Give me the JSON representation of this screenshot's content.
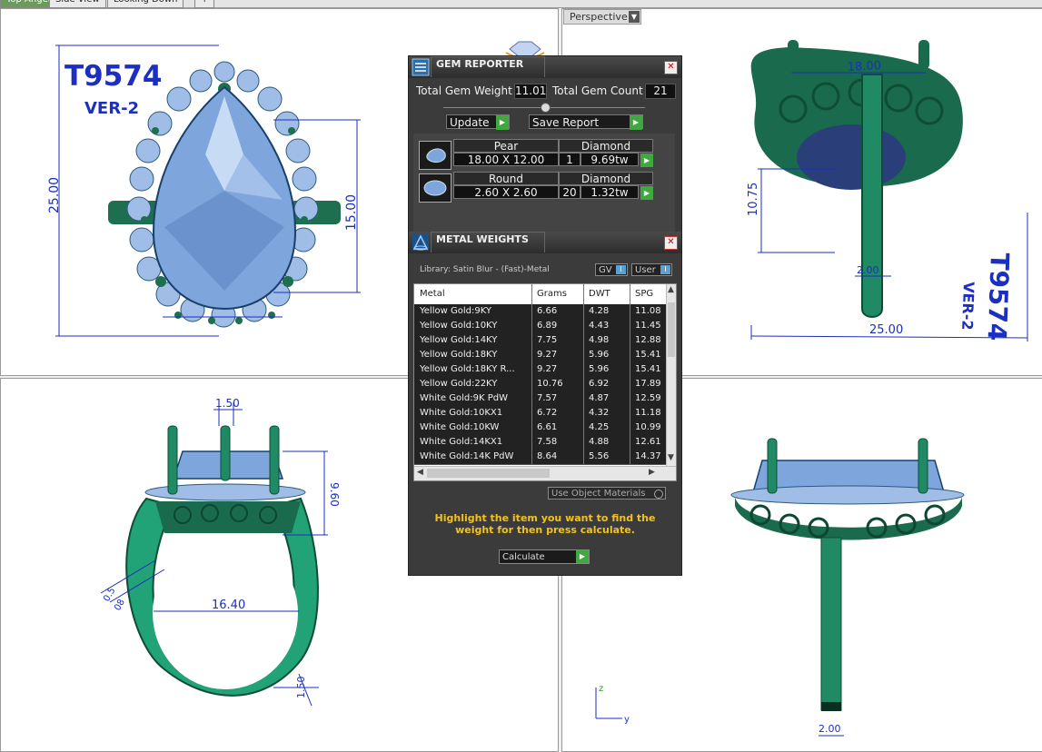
{
  "tabs": [
    {
      "label": "Top Angel",
      "active": true
    },
    {
      "label": "Side View",
      "active": false
    },
    {
      "label": "Looking Down",
      "active": false
    },
    {
      "label": "+",
      "active": false
    }
  ],
  "perspective": {
    "label": "Perspective",
    "arrow": "▼"
  },
  "top_left_view": {
    "model_id": "T9574",
    "version": "VER-2",
    "dim_height": "25.00",
    "dim_inner": "15.00"
  },
  "top_right_view": {
    "dim_top": "18.00",
    "dim_side": "10.75",
    "dim_shank": "2.00",
    "dim_bottom": "25.00",
    "model_id": "T9574",
    "version": "VER-2"
  },
  "bottom_left_view": {
    "dim_prong": "1.50",
    "dim_height": "9.60",
    "dim_inner": "16.40",
    "dim_shank": "1.50",
    "dim_angled_1": "0.5",
    "dim_angled_2": "08"
  },
  "bottom_right_view": {
    "dim_shank": "2.00",
    "axis_z": "z",
    "axis_y": "y"
  },
  "gem_reporter": {
    "title": "GEM REPORTER",
    "close": "✕",
    "total_weight_label": "Total Gem Weight",
    "total_weight_value": "11.01",
    "total_count_label": "Total Gem Count",
    "total_count_value": "21",
    "update_label": "Update",
    "save_report_label": "Save Report",
    "gems": [
      {
        "shape": "Pear",
        "type": "Diamond",
        "size": "18.00 X 12.00",
        "count": "1",
        "weight": "9.69tw"
      },
      {
        "shape": "Round",
        "type": "Diamond",
        "size": "2.60 X 2.60",
        "count": "20",
        "weight": "1.32tw"
      }
    ]
  },
  "metal_weights": {
    "title": "METAL WEIGHTS",
    "close": "✕",
    "library_label": "Library: Satin Blur - (Fast)-Metal",
    "gv_label": "GV",
    "user_label": "User",
    "columns": [
      "Metal",
      "Grams",
      "DWT",
      "SPG"
    ],
    "rows": [
      {
        "metal": "Yellow Gold:9KY",
        "grams": "6.66",
        "dwt": "4.28",
        "spg": "11.08"
      },
      {
        "metal": "Yellow Gold:10KY",
        "grams": "6.89",
        "dwt": "4.43",
        "spg": "11.45"
      },
      {
        "metal": "Yellow Gold:14KY",
        "grams": "7.75",
        "dwt": "4.98",
        "spg": "12.88"
      },
      {
        "metal": "Yellow Gold:18KY",
        "grams": "9.27",
        "dwt": "5.96",
        "spg": "15.41"
      },
      {
        "metal": "Yellow Gold:18KY R...",
        "grams": "9.27",
        "dwt": "5.96",
        "spg": "15.41"
      },
      {
        "metal": "Yellow Gold:22KY",
        "grams": "10.76",
        "dwt": "6.92",
        "spg": "17.89"
      },
      {
        "metal": "White Gold:9K PdW",
        "grams": "7.57",
        "dwt": "4.87",
        "spg": "12.59"
      },
      {
        "metal": "White Gold:10KX1",
        "grams": "6.72",
        "dwt": "4.32",
        "spg": "11.18"
      },
      {
        "metal": "White Gold:10KW",
        "grams": "6.61",
        "dwt": "4.25",
        "spg": "10.99"
      },
      {
        "metal": "White Gold:14KX1",
        "grams": "7.58",
        "dwt": "4.88",
        "spg": "12.61"
      },
      {
        "metal": "White Gold:14K PdW",
        "grams": "8.64",
        "dwt": "5.56",
        "spg": "14.37"
      }
    ],
    "use_object_materials_label": "Use Object Materials",
    "hint_text": "Highlight the item you want to find the weight for then press calculate.",
    "calculate_label": "Calculate"
  }
}
